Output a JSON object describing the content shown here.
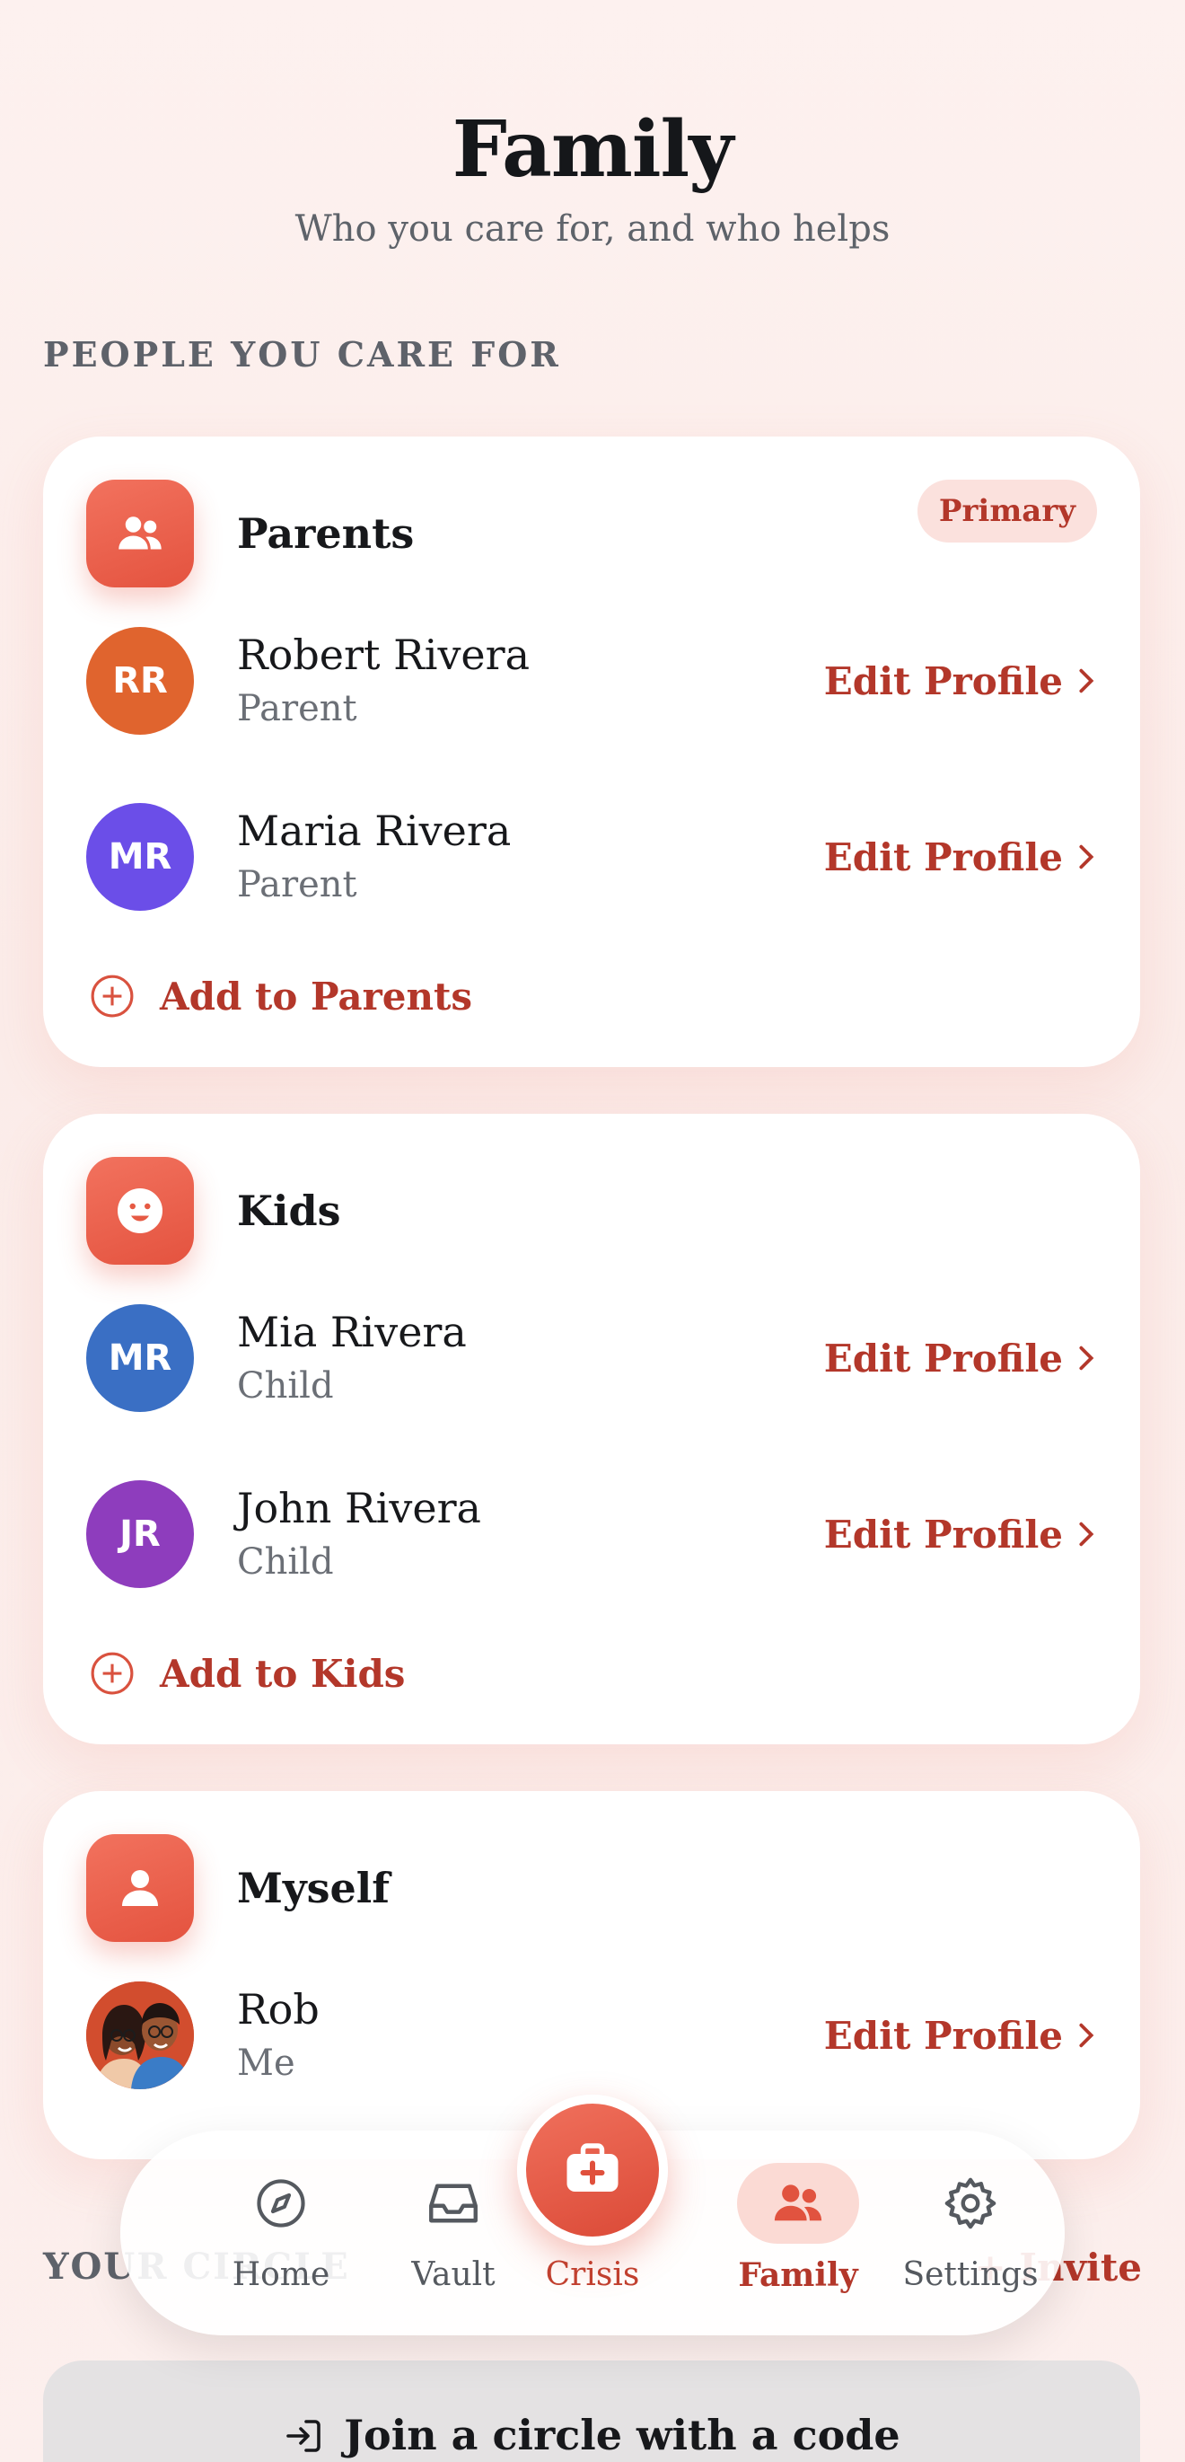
{
  "header": {
    "title": "Family",
    "subtitle": "Who you care for, and who helps"
  },
  "sections": {
    "care_for_label": "PEOPLE YOU CARE FOR",
    "circle_label": "YOUR CIRCLE",
    "invite_label": "+ Invite"
  },
  "groups": [
    {
      "title": "Parents",
      "icon": "people-icon",
      "badge": "Primary",
      "members": [
        {
          "initials": "RR",
          "name": "Robert Rivera",
          "role": "Parent",
          "color": "#e0642e"
        },
        {
          "initials": "MR",
          "name": "Maria Rivera",
          "role": "Parent",
          "color": "#6b4ee8"
        }
      ],
      "add_label": "Add to Parents"
    },
    {
      "title": "Kids",
      "icon": "smile-icon",
      "members": [
        {
          "initials": "MR",
          "name": "Mia Rivera",
          "role": "Child",
          "color": "#3a6fc4"
        },
        {
          "initials": "JR",
          "name": "John Rivera",
          "role": "Child",
          "color": "#8e3dbd"
        }
      ],
      "add_label": "Add to Kids"
    },
    {
      "title": "Myself",
      "icon": "person-icon",
      "members": [
        {
          "name": "Rob",
          "role": "Me",
          "avatar": "photo-avatar"
        }
      ]
    }
  ],
  "edit_label": "Edit Profile",
  "join": {
    "label": "Join a circle with a code"
  },
  "tabbar": {
    "tabs": [
      {
        "label": "Home",
        "icon": "compass-icon"
      },
      {
        "label": "Vault",
        "icon": "inbox-icon"
      },
      {
        "label": "Crisis",
        "icon": "first-aid-icon"
      },
      {
        "label": "Family",
        "icon": "people-icon",
        "active": true
      },
      {
        "label": "Settings",
        "icon": "gear-icon"
      }
    ]
  },
  "colors": {
    "accent": "#b3372a",
    "brand": "#ea5f4a",
    "badge_bg": "#fbe1dd"
  }
}
